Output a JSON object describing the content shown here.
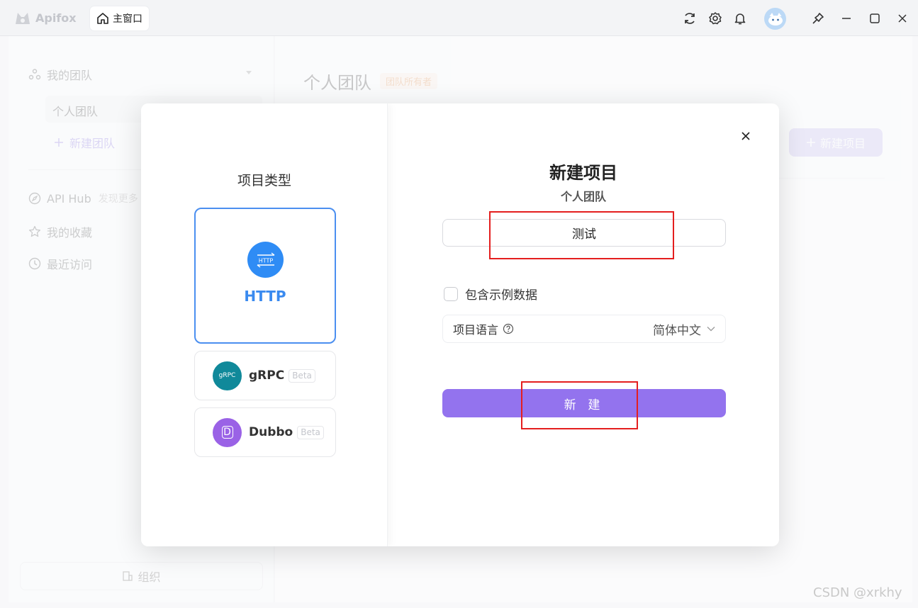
{
  "titlebar": {
    "app_name": "Apifox",
    "home_tab": "主窗口"
  },
  "sidebar": {
    "team_group": "我的团队",
    "current_team": "个人团队",
    "new_team": "新建团队",
    "api_hub": "API Hub",
    "api_hub_hint": "发现更多",
    "favorites": "我的收藏",
    "recent": "最近访问",
    "org_button": "组织"
  },
  "main": {
    "title": "个人团队",
    "owner_badge": "团队所有者",
    "new_project_button": "新建项目"
  },
  "modal": {
    "type_section_title": "项目类型",
    "types": [
      {
        "name": "HTTP",
        "icon_text": "HTTP",
        "selected": true
      },
      {
        "name": "gRPC",
        "icon_text": "gRPC",
        "beta": "Beta",
        "color": "#10899a"
      },
      {
        "name": "Dubbo",
        "icon_text": "D",
        "beta": "Beta",
        "color": "#9a62e6"
      }
    ],
    "title": "新建项目",
    "subtitle": "个人团队",
    "project_name_value": "测试",
    "include_sample": "包含示例数据",
    "language_label": "项目语言",
    "language_value": "简体中文",
    "create_button": "新 建"
  },
  "colors": {
    "accent_purple": "#9373ee",
    "http_blue": "#2f8cf5",
    "annotation_red": "#e41e1e"
  },
  "watermark": "CSDN @xrkhy"
}
